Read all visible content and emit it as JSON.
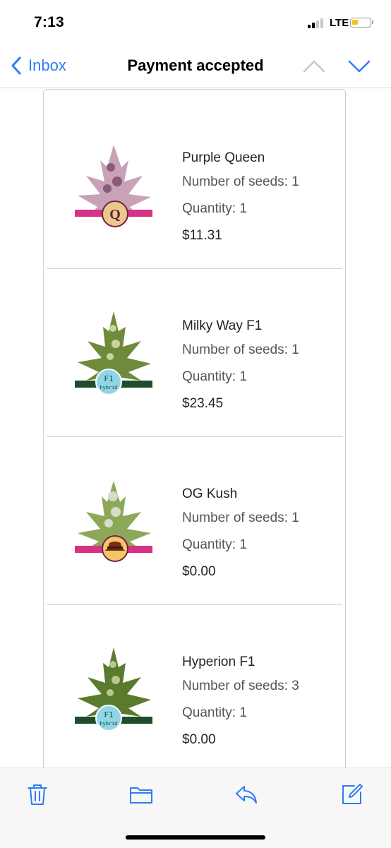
{
  "status_bar": {
    "time": "7:13",
    "network": "LTE"
  },
  "nav": {
    "back_label": "Inbox",
    "title": "Payment accepted"
  },
  "items": [
    {
      "name": "Purple Queen",
      "seeds": "Number of seeds: 1",
      "quantity": "Quantity: 1",
      "price": "$11.31",
      "badge": "Q",
      "badge_color": "#d63384"
    },
    {
      "name": "Milky Way F1",
      "seeds": "Number of seeds: 1",
      "quantity": "Quantity: 1",
      "price": "$23.45",
      "badge": "F1 hybrid",
      "badge_color": "#1f4d2b"
    },
    {
      "name": "OG Kush",
      "seeds": "Number of seeds: 1",
      "quantity": "Quantity: 1",
      "price": "$0.00",
      "badge": "hat",
      "badge_color": "#d63384"
    },
    {
      "name": "Hyperion F1",
      "seeds": "Number of seeds: 3",
      "quantity": "Quantity: 1",
      "price": "$0.00",
      "badge": "F1 hybrid",
      "badge_color": "#1f4d2b"
    }
  ],
  "toolbar": {
    "icons": [
      "trash-icon",
      "folder-icon",
      "reply-icon",
      "compose-icon"
    ],
    "accent": "#2f7cf6"
  }
}
